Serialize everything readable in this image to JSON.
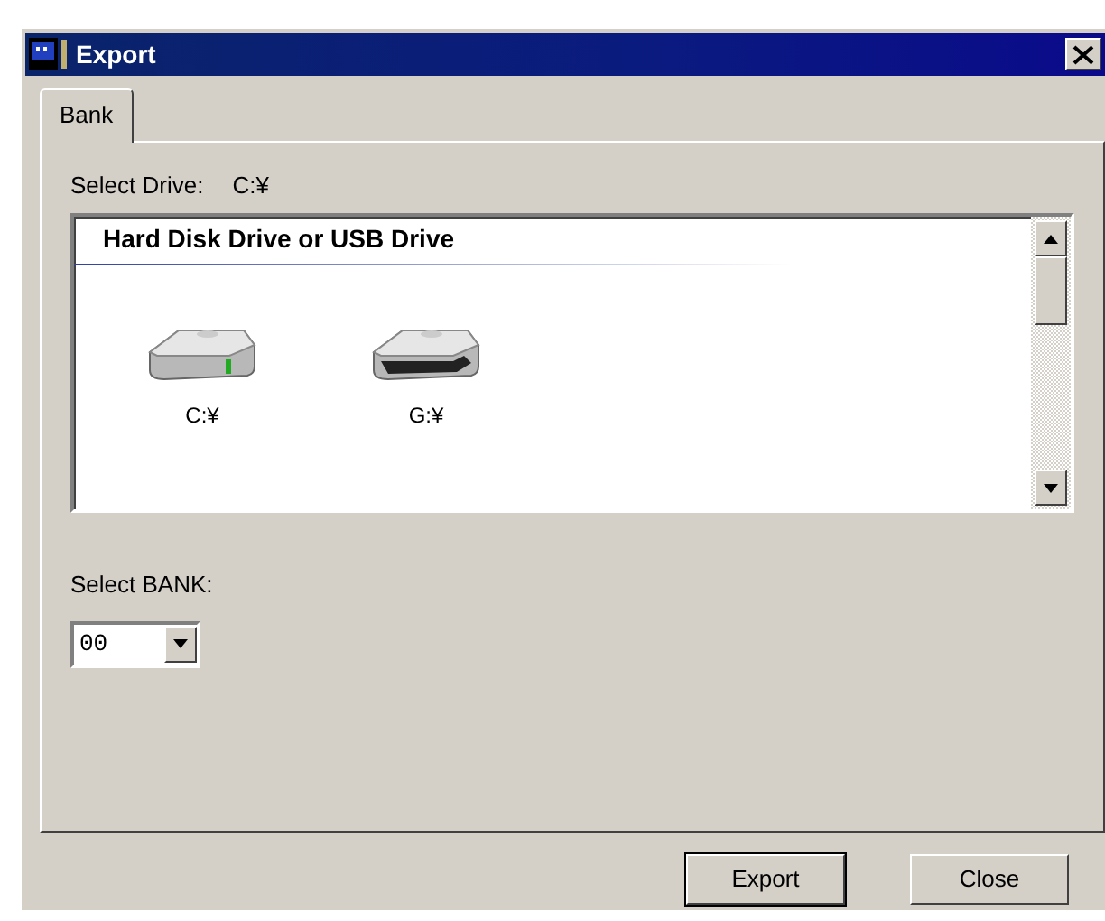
{
  "window": {
    "title": "Export"
  },
  "tabs": [
    {
      "label": "Bank",
      "selected": true
    }
  ],
  "drive_label": "Select Drive:",
  "drive_value": "C:¥",
  "drive_list": {
    "header": "Hard Disk Drive or USB Drive",
    "items": [
      {
        "label": "C:¥",
        "kind": "hdd"
      },
      {
        "label": "G:¥",
        "kind": "removable"
      }
    ]
  },
  "bank_label": "Select BANK:",
  "bank_select": {
    "value": "00"
  },
  "buttons": [
    {
      "label": "Export",
      "default": true
    },
    {
      "label": "Close",
      "default": false
    }
  ]
}
